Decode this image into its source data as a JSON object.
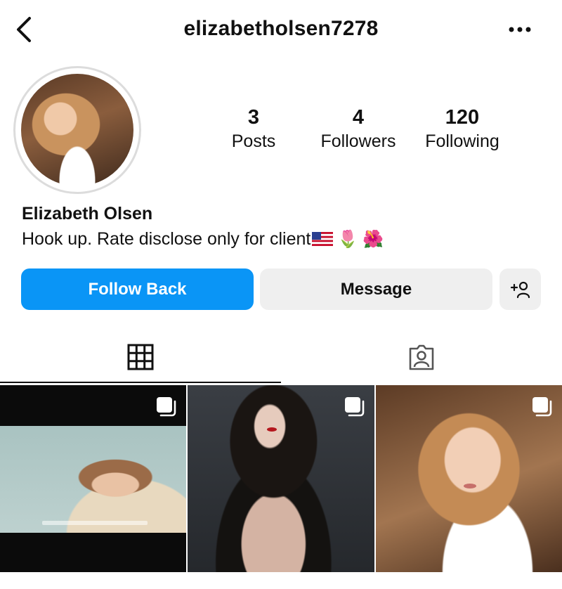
{
  "header": {
    "username": "elizabetholsen7278",
    "back_icon": "chevron-left-icon",
    "more_icon": "more-horizontal-icon"
  },
  "profile": {
    "avatar_icon": "avatar",
    "stats": {
      "posts": {
        "count": "3",
        "label": "Posts"
      },
      "followers": {
        "count": "4",
        "label": "Followers"
      },
      "following": {
        "count": "120",
        "label": "Following"
      }
    },
    "name": "Elizabeth Olsen",
    "bio": "Hook up. Rate disclose only for client",
    "bio_emojis": [
      "🌷",
      "🌺"
    ],
    "bio_flag_icon": "us-flag-icon"
  },
  "actions": {
    "follow_back": "Follow Back",
    "message": "Message",
    "add_user_icon": "add-person-icon",
    "follow_color": "#0a95f6",
    "secondary_color": "#efefef"
  },
  "tabs": {
    "grid_icon": "grid-icon",
    "tagged_icon": "tagged-person-icon",
    "active": "grid"
  },
  "posts": [
    {
      "icon": "multiple-photos-icon"
    },
    {
      "icon": "multiple-photos-icon"
    },
    {
      "icon": "multiple-photos-icon"
    }
  ]
}
